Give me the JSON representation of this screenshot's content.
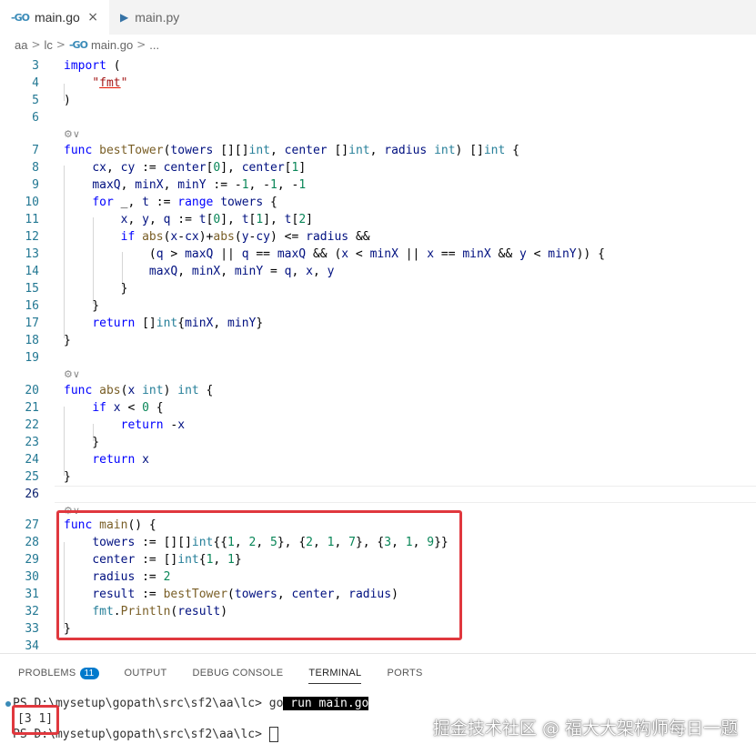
{
  "tabs": [
    {
      "label": "main.go",
      "icon": "go-icon",
      "close": "×"
    },
    {
      "label": "main.py",
      "icon": "python-icon"
    }
  ],
  "go_icon_glyph": "-GO",
  "py_icon_glyph": "▶",
  "breadcrumb": {
    "items": [
      "aa",
      "lc",
      "main.go",
      "..."
    ],
    "separator": ">"
  },
  "editor": {
    "lens_glyph": "⚙∨",
    "lines": {
      "3": "3",
      "4": "4",
      "5": "5",
      "6": "6",
      "7": "7",
      "8": "8",
      "9": "9",
      "10": "10",
      "11": "11",
      "12": "12",
      "13": "13",
      "14": "14",
      "15": "15",
      "16": "16",
      "17": "17",
      "18": "18",
      "19": "19",
      "20": "20",
      "21": "21",
      "22": "22",
      "23": "23",
      "24": "24",
      "25": "25",
      "26": "26",
      "27": "27",
      "28": "28",
      "29": "29",
      "30": "30",
      "31": "31",
      "32": "32",
      "33": "33",
      "34": "34"
    }
  },
  "panel": {
    "tabs": [
      "PROBLEMS",
      "OUTPUT",
      "DEBUG CONSOLE",
      "TERMINAL",
      "PORTS"
    ],
    "problems_count": "11",
    "terminal": {
      "line1_prompt": "PS D:\\mysetup\\gopath\\src\\sf2\\aa\\lc> ",
      "line1_cmd_a": "go",
      "line1_cmd_b": " run main.go",
      "line2_output": "[3 1]",
      "line3_prompt": "PS D:\\mysetup\\gopath\\src\\sf2\\aa\\lc> "
    }
  },
  "watermark": "掘金技术社区 @ 福大大架构师每日一题",
  "colors": {
    "keyword": "#0000ff",
    "function": "#795e26",
    "type": "#267f99",
    "string": "#a31515",
    "number": "#098658",
    "variable": "#001080",
    "line_number": "#237893",
    "highlight_box": "#e0383e",
    "badge": "#007acc"
  }
}
